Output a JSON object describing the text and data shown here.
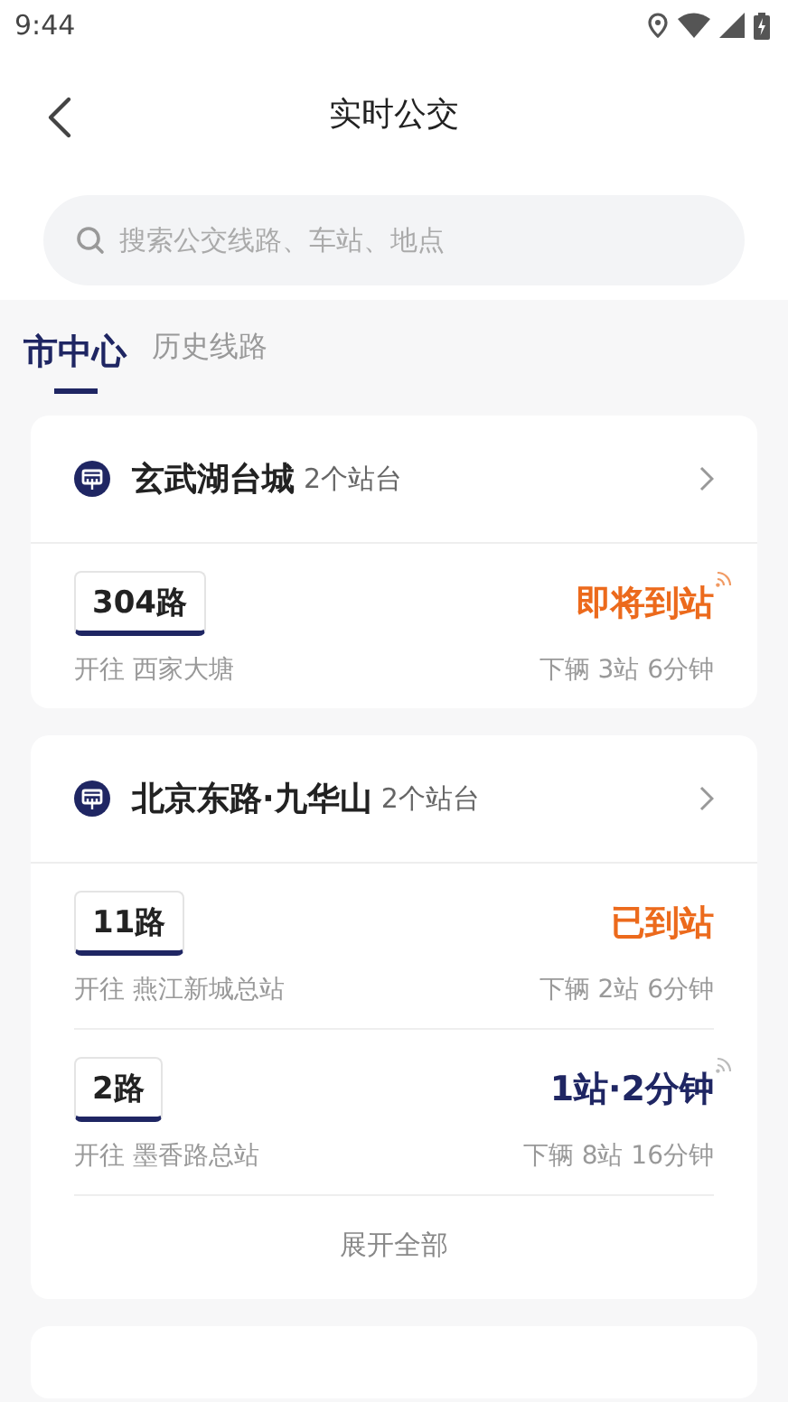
{
  "status_bar": {
    "time": "9:44"
  },
  "header": {
    "title": "实时公交"
  },
  "search": {
    "placeholder": "搜索公交线路、车站、地点"
  },
  "tabs": [
    {
      "label": "市中心",
      "selected": true
    },
    {
      "label": "历史线路",
      "selected": false
    }
  ],
  "stops": [
    {
      "name": "玄武湖台城",
      "platforms": "2个站台",
      "routes": [
        {
          "line": "304路",
          "destination": "开往 西家大塘",
          "status": "即将到站",
          "kind": "arriving",
          "live": true,
          "next": "下辆 3站 6分钟"
        }
      ]
    },
    {
      "name": "北京东路·九华山",
      "platforms": "2个站台",
      "routes": [
        {
          "line": "11路",
          "destination": "开往 燕江新城总站",
          "status": "已到站",
          "kind": "arrived",
          "live": false,
          "next": "下辆 2站 6分钟"
        },
        {
          "line": "2路",
          "destination": "开往 墨香路总站",
          "status": "1站·2分钟",
          "kind": "eta",
          "live": true,
          "next": "下辆 8站 16分钟"
        }
      ],
      "expand": "展开全部"
    },
    {
      "kind": "partial"
    }
  ]
}
